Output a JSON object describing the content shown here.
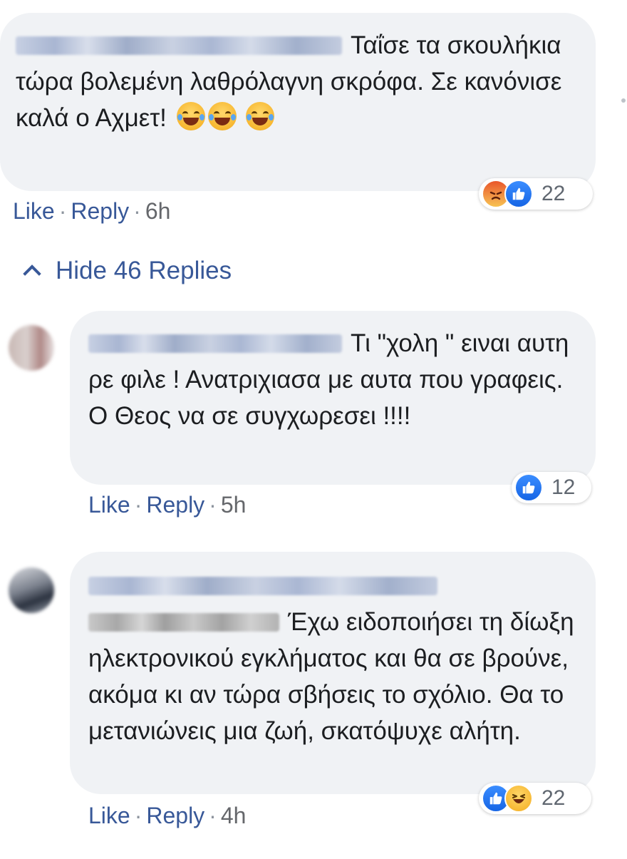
{
  "comments": [
    {
      "text": "Ταΐσε τα σκουλήκια τώρα βολεμένη λαθρόλαγνη σκρόφα. Σε κανόνισε καλά ο Αχμετ!",
      "reactions": [
        "angry-icon",
        "like-icon"
      ],
      "reaction_count": "22",
      "actions": {
        "like": "Like",
        "reply": "Reply",
        "time": "6h"
      }
    },
    {
      "text_line1": "Τι \"χολη \" ειναι",
      "text_rest": "αυτη ρε φιλε ! Ανατριχιασα με αυτα που γραφεις. Ο Θεος να σε συγχωρεσει !!!!",
      "reactions": [
        "like-icon"
      ],
      "reaction_count": "12",
      "actions": {
        "like": "Like",
        "reply": "Reply",
        "time": "5h"
      }
    },
    {
      "text": "Έχω ειδοποιήσει τη δίωξη ηλεκτρονικού εγκλήματος και θα σε βρούνε, ακόμα κι αν τώρα σβήσεις το σχόλιο. Θα το μετανιώνεις μια ζωή, σκατόψυχε αλήτη.",
      "reactions": [
        "like-icon",
        "haha-icon"
      ],
      "reaction_count": "22",
      "actions": {
        "like": "Like",
        "reply": "Reply",
        "time": "4h"
      }
    }
  ],
  "thread": {
    "hide_replies_label": "Hide 46 Replies"
  },
  "colors": {
    "link": "#385898",
    "bubble": "#f0f2f5",
    "like": "#1877f2"
  }
}
